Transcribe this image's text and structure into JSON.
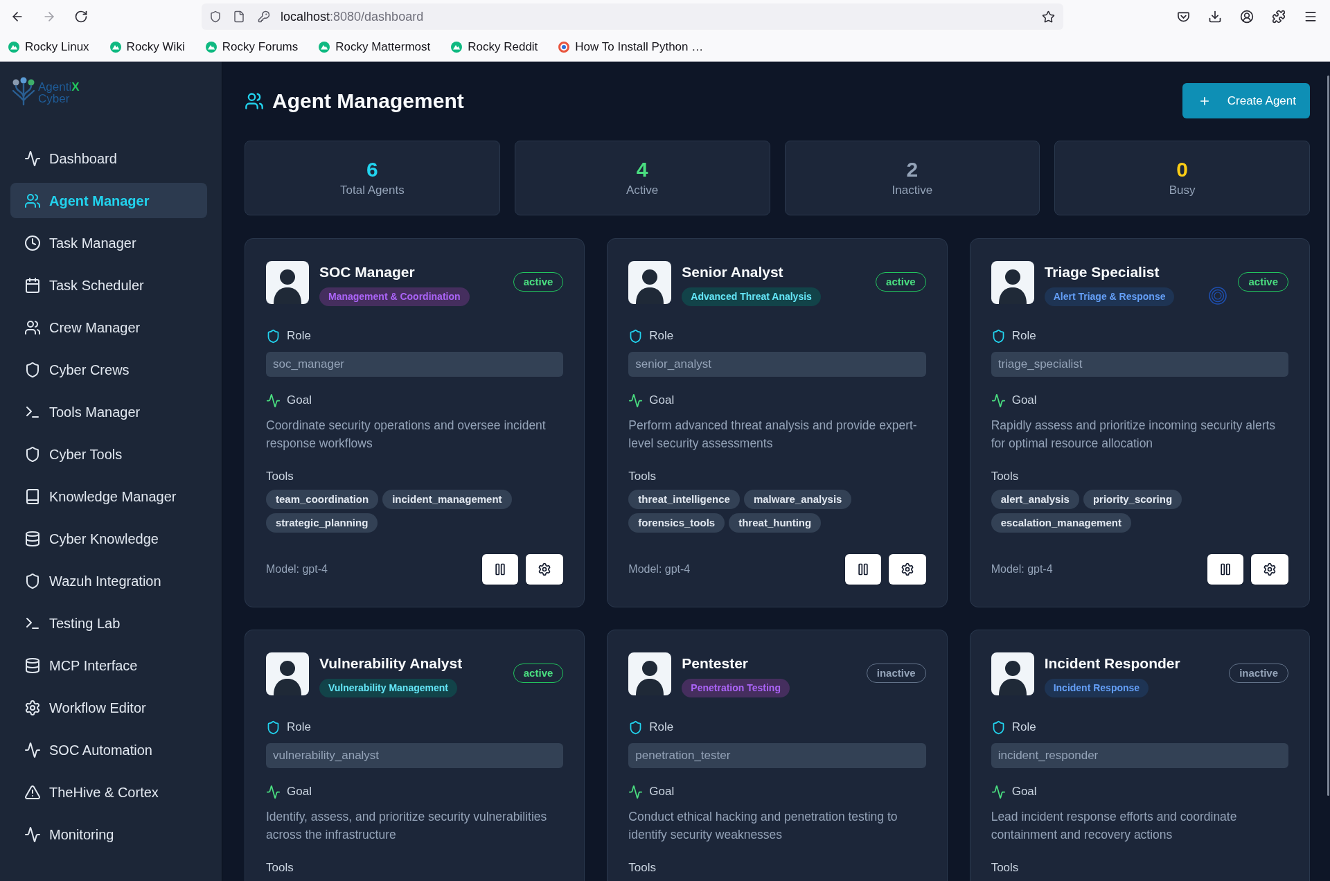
{
  "browser": {
    "url": {
      "host": "localhost",
      "path": ":8080/dashboard"
    },
    "bookmarks": [
      {
        "label": "Rocky Linux",
        "kind": "community"
      },
      {
        "label": "Rocky Wiki",
        "kind": "community"
      },
      {
        "label": "Rocky Forums",
        "kind": "community"
      },
      {
        "label": "Rocky Mattermost",
        "kind": "community"
      },
      {
        "label": "Rocky Reddit",
        "kind": "community"
      },
      {
        "label": "How To Install Python …",
        "kind": "article"
      }
    ]
  },
  "sidebar": {
    "logo": {
      "name": "Agenti",
      "accent": "X",
      "subtitle": "Cyber"
    },
    "items": [
      {
        "label": "Dashboard",
        "selected": false
      },
      {
        "label": "Agent Manager",
        "selected": true
      },
      {
        "label": "Task Manager",
        "selected": false
      },
      {
        "label": "Task Scheduler",
        "selected": false
      },
      {
        "label": "Crew Manager",
        "selected": false
      },
      {
        "label": "Cyber Crews",
        "selected": false
      },
      {
        "label": "Tools Manager",
        "selected": false
      },
      {
        "label": "Cyber Tools",
        "selected": false
      },
      {
        "label": "Knowledge Manager",
        "selected": false
      },
      {
        "label": "Cyber Knowledge",
        "selected": false
      },
      {
        "label": "Wazuh Integration",
        "selected": false
      },
      {
        "label": "Testing Lab",
        "selected": false
      },
      {
        "label": "MCP Interface",
        "selected": false
      },
      {
        "label": "Workflow Editor",
        "selected": false
      },
      {
        "label": "SOC Automation",
        "selected": false
      },
      {
        "label": "TheHive & Cortex",
        "selected": false
      },
      {
        "label": "Monitoring",
        "selected": false
      }
    ]
  },
  "header": {
    "title": "Agent Management",
    "create_button": "Create Agent"
  },
  "stats": [
    {
      "value": "6",
      "label": "Total Agents",
      "color": "#22d3ee"
    },
    {
      "value": "4",
      "label": "Active",
      "color": "#4ade80"
    },
    {
      "value": "2",
      "label": "Inactive",
      "color": "#94a3b8"
    },
    {
      "value": "0",
      "label": "Busy",
      "color": "#facc15"
    }
  ],
  "agents": [
    {
      "name": "SOC Manager",
      "specialty": {
        "label": "Management & Coordination",
        "color": "#452e5e"
      },
      "status": {
        "label": "active",
        "active": true
      },
      "processing": false,
      "role_label": "Role",
      "role": "soc_manager",
      "goal_label": "Goal",
      "goal": "Coordinate security operations and oversee incident response workflows",
      "tools_label": "Tools",
      "tools": [
        "team_coordination",
        "incident_management",
        "strategic_planning"
      ],
      "model": "Model: gpt-4"
    },
    {
      "name": "Senior Analyst",
      "specialty": {
        "label": "Advanced Threat Analysis",
        "color": "#124349"
      },
      "status": {
        "label": "active",
        "active": true
      },
      "processing": false,
      "role_label": "Role",
      "role": "senior_analyst",
      "goal_label": "Goal",
      "goal": "Perform advanced threat analysis and provide expert-level security assessments",
      "tools_label": "Tools",
      "tools": [
        "threat_intelligence",
        "malware_analysis",
        "forensics_tools",
        "threat_hunting"
      ],
      "model": "Model: gpt-4"
    },
    {
      "name": "Triage Specialist",
      "specialty": {
        "label": "Alert Triage & Response",
        "color": "#1e3454"
      },
      "status": {
        "label": "active",
        "active": true
      },
      "processing": true,
      "role_label": "Role",
      "role": "triage_specialist",
      "goal_label": "Goal",
      "goal": "Rapidly assess and prioritize incoming security alerts for optimal resource allocation",
      "tools_label": "Tools",
      "tools": [
        "alert_analysis",
        "priority_scoring",
        "escalation_management"
      ],
      "model": "Model: gpt-4"
    },
    {
      "name": "Vulnerability Analyst",
      "specialty": {
        "label": "Vulnerability Management",
        "color": "#124349"
      },
      "status": {
        "label": "active",
        "active": true
      },
      "processing": false,
      "role_label": "Role",
      "role": "vulnerability_analyst",
      "goal_label": "Goal",
      "goal": "Identify, assess, and prioritize security vulnerabilities across the infrastructure",
      "tools_label": "Tools"
    },
    {
      "name": "Pentester",
      "specialty": {
        "label": "Penetration Testing",
        "color": "#452e5e"
      },
      "status": {
        "label": "inactive",
        "active": false
      },
      "processing": false,
      "role_label": "Role",
      "role": "penetration_tester",
      "goal_label": "Goal",
      "goal": "Conduct ethical hacking and penetration testing to identify security weaknesses",
      "tools_label": "Tools"
    },
    {
      "name": "Incident Responder",
      "specialty": {
        "label": "Incident Response",
        "color": "#1e3454"
      },
      "status": {
        "label": "inactive",
        "active": false
      },
      "processing": false,
      "role_label": "Role",
      "role": "incident_responder",
      "goal_label": "Goal",
      "goal": "Lead incident response efforts and coordinate containment and recovery actions",
      "tools_label": "Tools"
    }
  ]
}
